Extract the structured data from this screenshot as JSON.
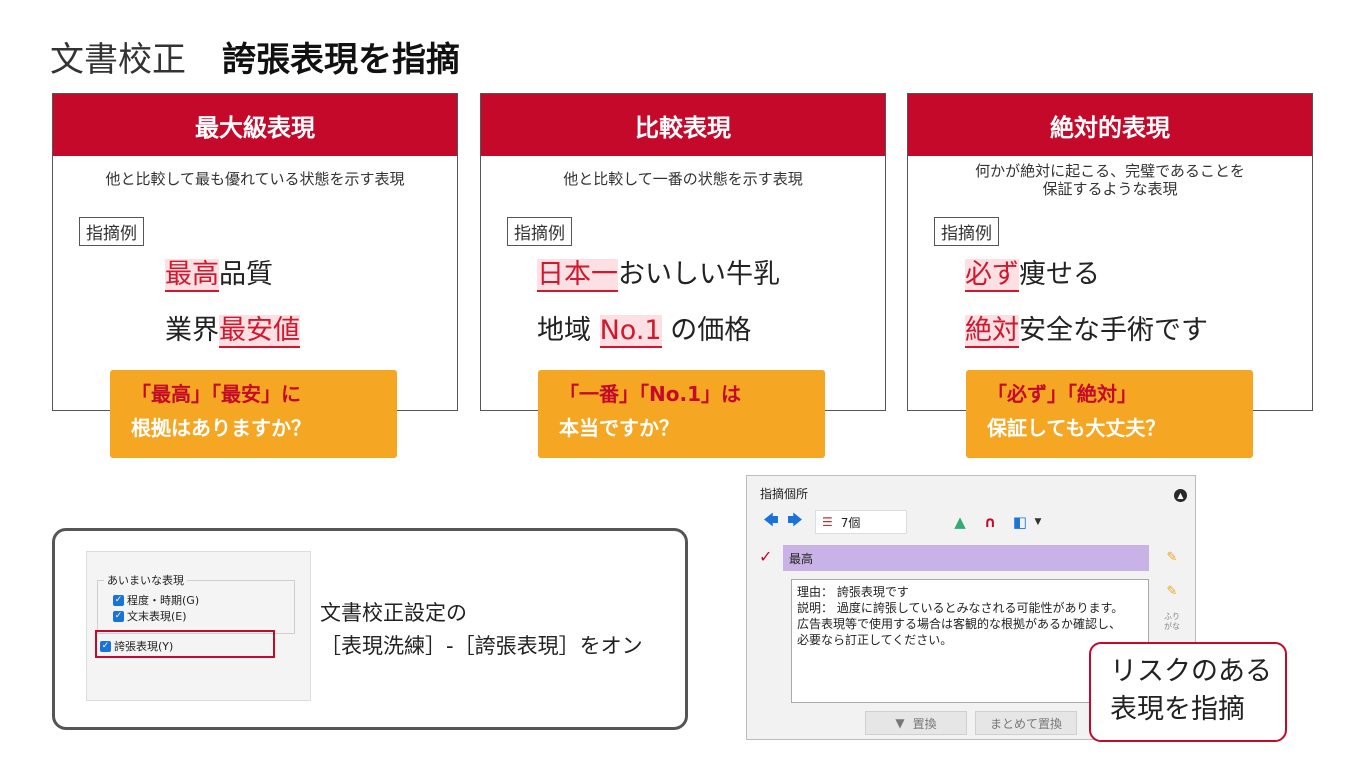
{
  "header": {
    "title": "文書校正",
    "subtitle": "誇張表現を指摘"
  },
  "cards": [
    {
      "title": "最大級表現",
      "description": [
        "他と比較して最も優れている状態を示す表現"
      ],
      "tag": "指摘例",
      "examples": [
        {
          "pre": "",
          "hl": "最高",
          "post": "品質"
        },
        {
          "pre": "業界",
          "hl": "最安値",
          "post": ""
        }
      ],
      "callout": {
        "line1": "「最高」「最安」に",
        "line2": "根拠はありますか？"
      }
    },
    {
      "title": "比較表現",
      "description": [
        "他と比較して一番の状態を示す表現"
      ],
      "tag": "指摘例",
      "examples": [
        {
          "pre": "",
          "hl": "日本一",
          "post": "おいしい牛乳"
        },
        {
          "pre": "地域",
          "hl": "No.1",
          "post": "の価格"
        }
      ],
      "callout": {
        "line1": "「一番」「No.1」は",
        "line2": "本当ですか？"
      }
    },
    {
      "title": "絶対的表現",
      "description": [
        "何かが絶対に起こる、完璧であることを",
        "保証するような表現"
      ],
      "tag": "指摘例",
      "examples": [
        {
          "pre": "",
          "hl": "必ず",
          "post": "痩せる"
        },
        {
          "pre": "",
          "hl": "絶対",
          "post": "安全な手術です"
        }
      ],
      "callout": {
        "line1": "「必ず」「絶対」",
        "line2": "保証しても大丈夫？"
      }
    }
  ],
  "settings": {
    "group_label": "あいまいな表現",
    "options": [
      "程度・時期(G)",
      "文末表現(E)",
      "誇張表現(Y)"
    ],
    "text_line1": "文書校正設定の",
    "text_line2": "［表現洗練］-［誇張表現］をオン"
  },
  "panel": {
    "title": "指摘個所",
    "count": "7個",
    "item": "最高",
    "detail_lines": [
      "理由： 誇張表現です",
      "説明： 過度に誇張しているとみなされる可能性があります。",
      "広告表現等で使用する場合は客観的な根拠があるか確認し、",
      "必要なら訂正してください。"
    ],
    "furigana": [
      "ふり",
      "がな"
    ],
    "replace_label": "置換",
    "replace_all_label": "まとめて置換"
  },
  "risk_callout": {
    "line1": "リスクのある",
    "line2": "表現を指摘"
  },
  "colors": {
    "accent_red": "#c4092a",
    "callout_orange": "#f5a623",
    "highlight_bg": "#fde0e3"
  }
}
